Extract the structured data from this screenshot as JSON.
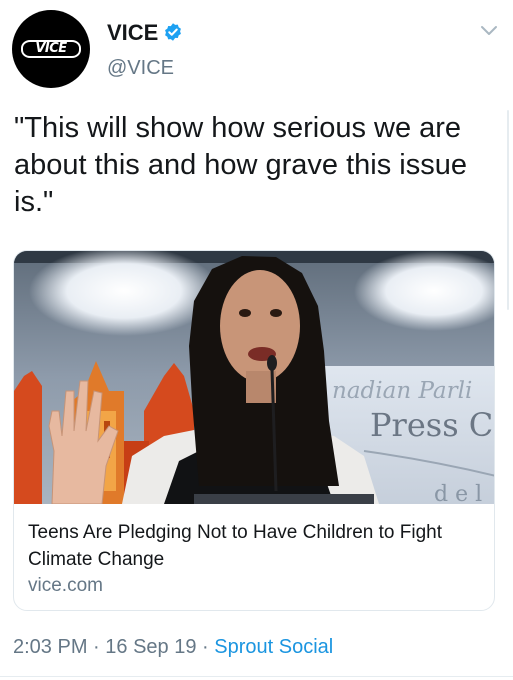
{
  "author": {
    "display_name": "VICE",
    "handle": "@VICE",
    "avatar_logo_text": "VICE",
    "verified": true
  },
  "tweet": {
    "text": "\"This will show how serious we are about this and how grave this issue is.\""
  },
  "link_card": {
    "image_sign_line1": "nadian Parli",
    "image_sign_line2": "Press C",
    "title": "Teens Are Pledging Not to Have Children to Fight Climate Change",
    "domain": "vice.com"
  },
  "footer": {
    "time": "2:03 PM",
    "separator": " · ",
    "date": "16 Sep 19",
    "source": "Sprout Social"
  },
  "colors": {
    "link_blue": "#1b95e0",
    "verified_blue": "#1da1f2",
    "secondary_text": "#657786",
    "primary_text": "#14171a"
  },
  "icons": {
    "verified": "verified-badge-icon",
    "caret": "chevron-down-icon"
  }
}
